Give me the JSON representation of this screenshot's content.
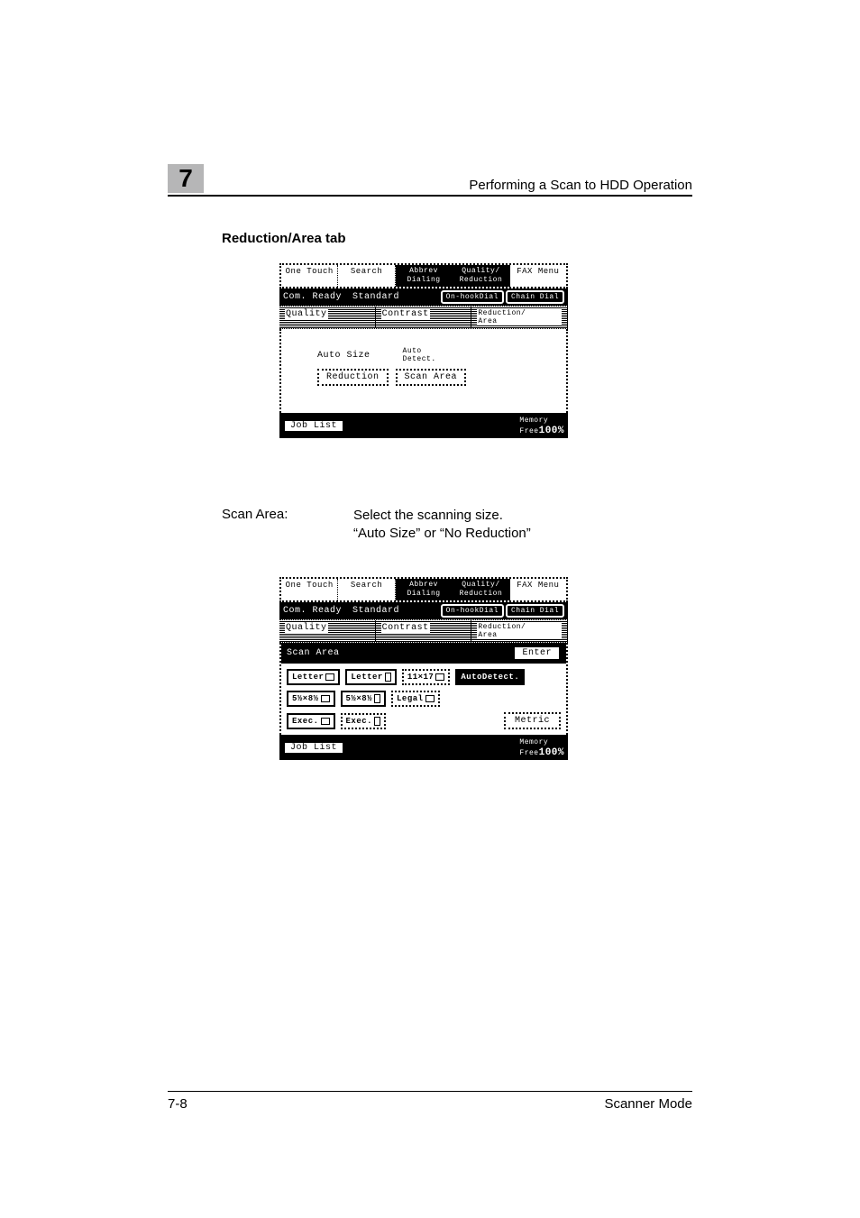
{
  "header": {
    "chapter": "7",
    "title": "Performing a Scan to HDD Operation"
  },
  "section_title": "Reduction/Area tab",
  "panel1": {
    "tabs": [
      "One Touch",
      "Search",
      "Abbrev\nDialing",
      "Quality/\nReduction",
      "FAX Menu"
    ],
    "status": {
      "text": "Com. Ready",
      "mode": "Standard",
      "pills": [
        "On-hookDial",
        "Chain Dial"
      ]
    },
    "subtabs": {
      "items": [
        "Quality",
        "Contrast",
        "Reduction/\nArea"
      ],
      "active": 2
    },
    "auto_size_label": "Auto Size",
    "auto_detect_label": "Auto\nDetect.",
    "reduction_btn": "Reduction",
    "scan_area_btn": "Scan Area",
    "footer": {
      "joblist": "Job List",
      "mem_label": "Memory\nFree",
      "mem_value": "100%"
    }
  },
  "desc": {
    "label": "Scan Area:",
    "line1": "Select the scanning size.",
    "line2": "“Auto Size” or “No Reduction”"
  },
  "panel2": {
    "tabs": [
      "One Touch",
      "Search",
      "Abbrev\nDialing",
      "Quality/\nReduction",
      "FAX Menu"
    ],
    "status": {
      "text": "Com. Ready",
      "mode": "Standard",
      "pills": [
        "On-hookDial",
        "Chain Dial"
      ]
    },
    "subtabs": {
      "items": [
        "Quality",
        "Contrast",
        "Reduction/\nArea"
      ],
      "active": 2
    },
    "scan_area_title": "Scan Area",
    "enter": "Enter",
    "sizes_row1": [
      "Letter",
      "Letter",
      "11×17",
      "AutoDetect."
    ],
    "sizes_row2": [
      "5½×8½",
      "5½×8½",
      "Legal"
    ],
    "sizes_row3": [
      "Exec.",
      "Exec."
    ],
    "metric": "Metric",
    "footer": {
      "joblist": "Job List",
      "mem_label": "Memory\nFree",
      "mem_value": "100%"
    }
  },
  "page_footer": {
    "left": "7-8",
    "right": "Scanner Mode"
  }
}
